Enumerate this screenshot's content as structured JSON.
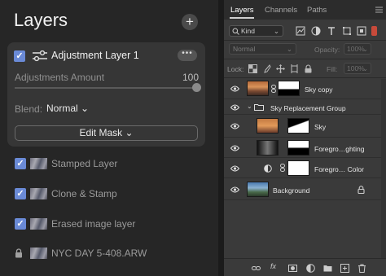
{
  "left_panel": {
    "title": "Layers",
    "add_button": "+",
    "adjustment_card": {
      "title": "Adjustment Layer 1",
      "more_button": "•••",
      "amount_label": "Adjustments Amount",
      "amount_value": "100",
      "amount_fraction": 1.0,
      "blend_label": "Blend:",
      "blend_value": "Normal ⌄",
      "edit_mask_button": "Edit Mask ⌄"
    },
    "layers": [
      {
        "label": "Stamped Layer"
      },
      {
        "label": "Clone & Stamp"
      },
      {
        "label": "Erased image layer"
      },
      {
        "label": "NYC DAY 5-408.ARW"
      }
    ]
  },
  "right_panel": {
    "tabs": [
      "Layers",
      "Channels",
      "Paths"
    ],
    "active_tab": "Layers",
    "filter_kind": "Kind",
    "blend_mode": "Normal",
    "opacity_label": "Opacity:",
    "opacity_value": "100%",
    "lock_label": "Lock:",
    "fill_label": "Fill:",
    "fill_value": "100%",
    "layers": [
      {
        "name": "Sky copy"
      },
      {
        "name": "Sky Replacement Group"
      },
      {
        "name": "Sky"
      },
      {
        "name": "Foregro…ghting"
      },
      {
        "name": "Foregro… Color"
      },
      {
        "name": "Background"
      }
    ]
  },
  "colors": {
    "accent_check": "#6a8ad6",
    "panel_bg": "#262626",
    "ps_bg": "#3a3a3a"
  }
}
